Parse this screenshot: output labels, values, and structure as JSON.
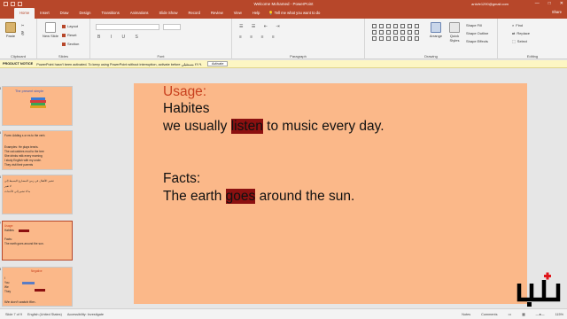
{
  "window": {
    "title": "Welcome Mohamed  -  PowerPoint",
    "user": "anlvfe1290@gmail.com",
    "controls": [
      "—",
      "□",
      "✕"
    ]
  },
  "tabs": [
    "File",
    "Home",
    "Insert",
    "Draw",
    "Design",
    "Transitions",
    "Animations",
    "Slide Show",
    "Record",
    "Review",
    "View",
    "Help"
  ],
  "active_tab": "Home",
  "tell_me": "Tell me what you want to do",
  "share": "Share",
  "ribbon": {
    "groups": {
      "clipboard": "Clipboard",
      "slides": "Slides",
      "font": "Font",
      "paragraph": "Paragraph",
      "drawing": "Drawing",
      "editing": "Editing"
    },
    "paste": "Paste",
    "new_slide": "New Slide",
    "layout": "Layout",
    "reset": "Reset",
    "section": "Section",
    "arrange": "Arrange",
    "quick_styles": "Quick Styles",
    "shape_fill": "Shape Fill",
    "shape_outline": "Shape Outline",
    "shape_effects": "Shape Effects",
    "find": "Find",
    "replace": "Replace",
    "select": "Select"
  },
  "notice": {
    "label": "PRODUCT NOTICE",
    "text": "PowerPoint hasn't been activated. To keep using PowerPoint without interruption, activate before ٢/١٩ مستقبلي.",
    "button": "Activate"
  },
  "thumbnails": [
    {
      "num": "4",
      "title": "The present simple"
    },
    {
      "num": "5",
      "lines": [
        "Form: Adding s or es to the verb.",
        "",
        "Examples: He plays tennis.",
        "The cat catches mud to the tree",
        "She drinks milk every morning",
        "I study English with my uncle.",
        "They visit their parents"
      ]
    },
    {
      "num": "6",
      "lines": [
        "تشير الأفعال في زمن المضارع البسيط إلى",
        "لا تغير",
        "ما لا تشير إلى الأحداث",
        ""
      ]
    },
    {
      "num": "7",
      "lines": [
        "Usage:",
        "Habites",
        "",
        "Facts:",
        "The earth goes around the sun."
      ]
    },
    {
      "num": "8",
      "title": "Negative",
      "lines": [
        "I",
        "You",
        "We",
        "They",
        "",
        "We don't watch film."
      ]
    }
  ],
  "slide": {
    "usage_label": "Usage:",
    "habites": "Habites",
    "sentence1_before": "we usually ",
    "sentence1_highlight": "listen",
    "sentence1_after": " to music every day.",
    "facts_label": "Facts:",
    "sentence2_before": "The earth ",
    "sentence2_highlight": "goes",
    "sentence2_after": " around the sun."
  },
  "status": {
    "slide_info": "Slide 7 of 9",
    "language": "English (United States)",
    "accessibility": "Accessibility: Investigate",
    "notes": "Notes",
    "comments": "Comments",
    "zoom": "115%"
  },
  "colors": {
    "accent": "#b7472a",
    "slide_bg": "#fbb889",
    "highlight": "#8b1010",
    "usage_text": "#c8401e"
  }
}
